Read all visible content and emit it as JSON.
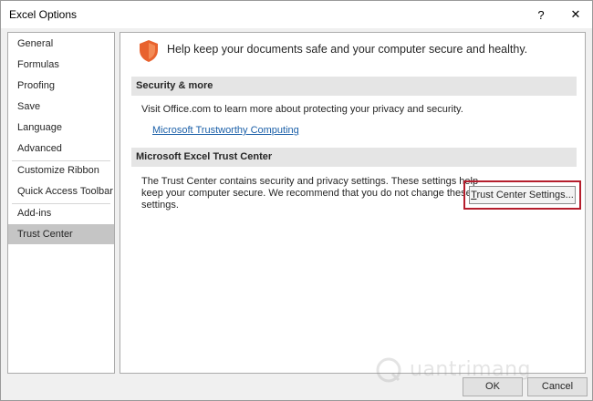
{
  "window": {
    "title": "Excel Options",
    "help_glyph": "?",
    "close_glyph": "✕"
  },
  "sidebar": {
    "items": [
      {
        "label": "General"
      },
      {
        "label": "Formulas"
      },
      {
        "label": "Proofing"
      },
      {
        "label": "Save"
      },
      {
        "label": "Language"
      },
      {
        "label": "Advanced"
      },
      {
        "label": "Customize Ribbon"
      },
      {
        "label": "Quick Access Toolbar"
      },
      {
        "label": "Add-ins"
      },
      {
        "label": "Trust Center"
      }
    ],
    "selected": "Trust Center"
  },
  "content": {
    "header": "Help keep your documents safe and your computer secure and healthy.",
    "security_section": {
      "title": "Security & more",
      "text": "Visit Office.com to learn more about protecting your privacy and security.",
      "link": "Microsoft Trustworthy Computing"
    },
    "trust_center_section": {
      "title": "Microsoft Excel Trust Center",
      "text_lines": [
        "The Trust Center contains security and privacy settings. These settings help",
        "keep your computer secure. We recommend that you do not change these",
        "settings."
      ],
      "button_label_underlined": "T",
      "button_label_rest": "rust Center Settings..."
    }
  },
  "footer": {
    "ok_label": "OK",
    "cancel_label": "Cancel"
  },
  "watermark": {
    "text": "uantrimang"
  },
  "icons": {
    "shield": "shield-icon"
  },
  "colors": {
    "accent_shield": "#e8622e",
    "highlight_frame": "#b51d2c",
    "link": "#1a5fa8"
  }
}
